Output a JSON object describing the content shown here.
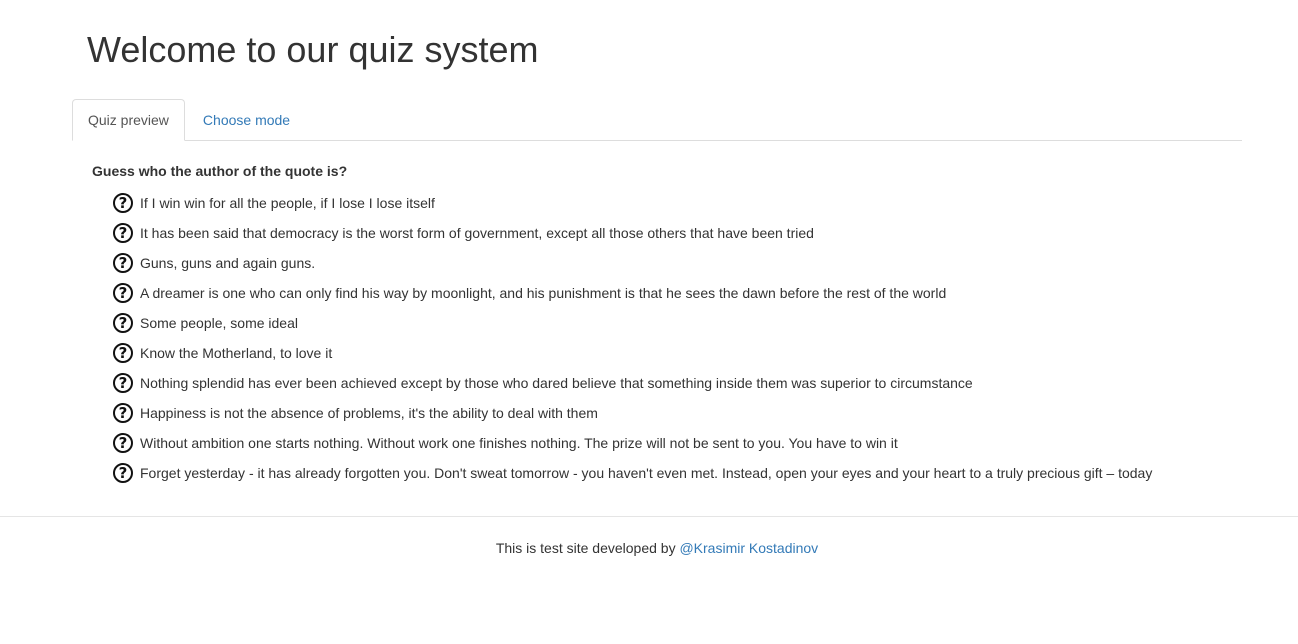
{
  "header": {
    "title": "Welcome to our quiz system"
  },
  "tabs": [
    {
      "label": "Quiz preview",
      "active": true
    },
    {
      "label": "Choose mode",
      "active": false
    }
  ],
  "quiz": {
    "question": "Guess who the author of the quote is?",
    "answer_icon": "question-circle-icon",
    "answers": [
      "If I win win for all the people, if I lose I lose itself",
      "It has been said that democracy is the worst form of government, except all those others that have been tried",
      "Guns, guns and again guns.",
      "A dreamer is one who can only find his way by moonlight, and his punishment is that he sees the dawn before the rest of the world",
      "Some people, some ideal",
      "Know the Motherland, to love it",
      "Nothing splendid has ever been achieved except by those who dared believe that something inside them was superior to circumstance",
      "Happiness is not the absence of problems, it's the ability to deal with them",
      "Without ambition one starts nothing. Without work one finishes nothing. The prize will not be sent to you. You have to win it",
      "Forget yesterday - it has already forgotten you. Don't sweat tomorrow - you haven't even met. Instead, open your eyes and your heart to a truly precious gift – today"
    ]
  },
  "footer": {
    "text": "This is test site developed by ",
    "author_link": "@Krasimir Kostadinov"
  },
  "colors": {
    "link": "#337ab7",
    "text": "#333333",
    "border": "#dddddd"
  }
}
